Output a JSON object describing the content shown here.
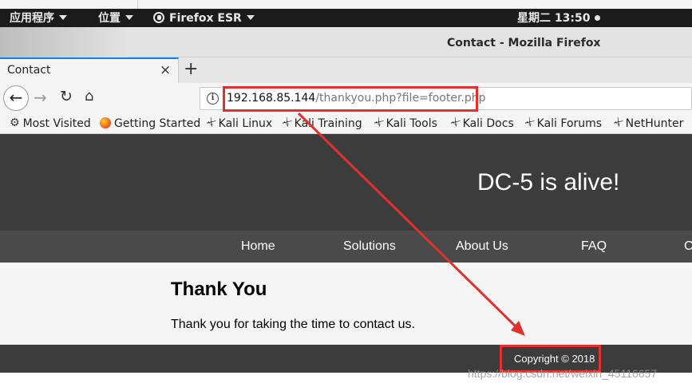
{
  "panel": {
    "applications": "应用程序",
    "places": "位置",
    "app_name": "Firefox ESR",
    "clock": "星期二 13:50"
  },
  "window": {
    "title": "Contact - Mozilla Firefox"
  },
  "tab": {
    "label": "Contact",
    "close_glyph": "×",
    "new_tab_glyph": "+"
  },
  "navbar": {
    "back_glyph": "←",
    "forward_glyph": "→",
    "reload_glyph": "↻",
    "home_glyph": "⌂",
    "url_host": "192.168.85.144",
    "url_path": "/thankyou.php?file=footer.php"
  },
  "bookmarks": [
    {
      "label": "Most Visited",
      "icon": "gear-icon"
    },
    {
      "label": "Getting Started",
      "icon": "firefox-icon"
    },
    {
      "label": "Kali Linux",
      "icon": "kali-dragon-icon"
    },
    {
      "label": "Kali Training",
      "icon": "kali-dragon-icon"
    },
    {
      "label": "Kali Tools",
      "icon": "kali-dragon-icon"
    },
    {
      "label": "Kali Docs",
      "icon": "kali-dragon-icon"
    },
    {
      "label": "Kali Forums",
      "icon": "kali-dragon-icon"
    },
    {
      "label": "NetHunter",
      "icon": "kali-dragon-icon"
    }
  ],
  "site": {
    "headline": "DC-5 is alive!",
    "nav": [
      "Home",
      "Solutions",
      "About Us",
      "FAQ",
      "C"
    ],
    "heading": "Thank You",
    "message": "Thank you for taking the time to contact us.",
    "footer": "Copyright © 2018"
  },
  "watermark": "https://blog.csdn.net/weixin_45116657",
  "colors": {
    "annotation": "#e0312f",
    "tab_accent": "#0a84ff",
    "hero_bg": "#3c3c3c",
    "nav_bg": "#4a4a4a"
  }
}
